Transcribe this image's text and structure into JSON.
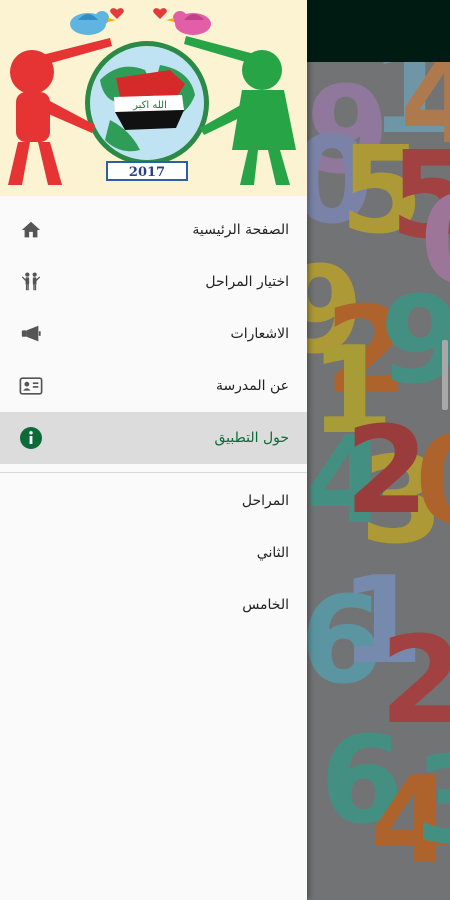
{
  "header": {
    "year": "2017",
    "logo_text": "الله اكبر"
  },
  "menu": {
    "items": [
      {
        "label": "الصفحة الرئيسية",
        "icon": "home-icon"
      },
      {
        "label": "اختيار المراحل",
        "icon": "kids-icon"
      },
      {
        "label": "الاشعارات",
        "icon": "megaphone-icon"
      },
      {
        "label": "عن المدرسة",
        "icon": "id-card-icon"
      },
      {
        "label": "حول التطبيق",
        "icon": "info-icon"
      }
    ],
    "selected_index": 4
  },
  "stages": {
    "header": "المراحل",
    "items": [
      "الثاني",
      "الخامس"
    ]
  },
  "background_numbers": [
    {
      "text": "9",
      "color": "#c8a7d8"
    },
    {
      "text": "1",
      "color": "#9ad0e6"
    },
    {
      "text": "4",
      "color": "#f2a86a"
    },
    {
      "text": "0",
      "color": "#a9b6e8"
    },
    {
      "text": "5",
      "color": "#f0d64c"
    },
    {
      "text": "5",
      "color": "#e15a5a"
    },
    {
      "text": "0",
      "color": "#d9a2d5"
    },
    {
      "text": "9",
      "color": "#f0d64c"
    },
    {
      "text": "2",
      "color": "#f08a3c"
    },
    {
      "text": "9",
      "color": "#5ec8b5"
    },
    {
      "text": "1",
      "color": "#e8d94a"
    },
    {
      "text": "4",
      "color": "#5ec8b5"
    },
    {
      "text": "3",
      "color": "#f0d64c"
    },
    {
      "text": "2",
      "color": "#d75454"
    },
    {
      "text": "0",
      "color": "#f08a3c"
    },
    {
      "text": "6",
      "color": "#7fcfe0"
    },
    {
      "text": "1",
      "color": "#a2c0f0"
    },
    {
      "text": "2",
      "color": "#e15a5a"
    },
    {
      "text": "6",
      "color": "#5ec8b5"
    },
    {
      "text": "4",
      "color": "#f08a3c"
    },
    {
      "text": "3",
      "color": "#5ec8b5"
    }
  ],
  "colors": {
    "accent": "#0d6b3a",
    "app_bar": "#00261a"
  }
}
